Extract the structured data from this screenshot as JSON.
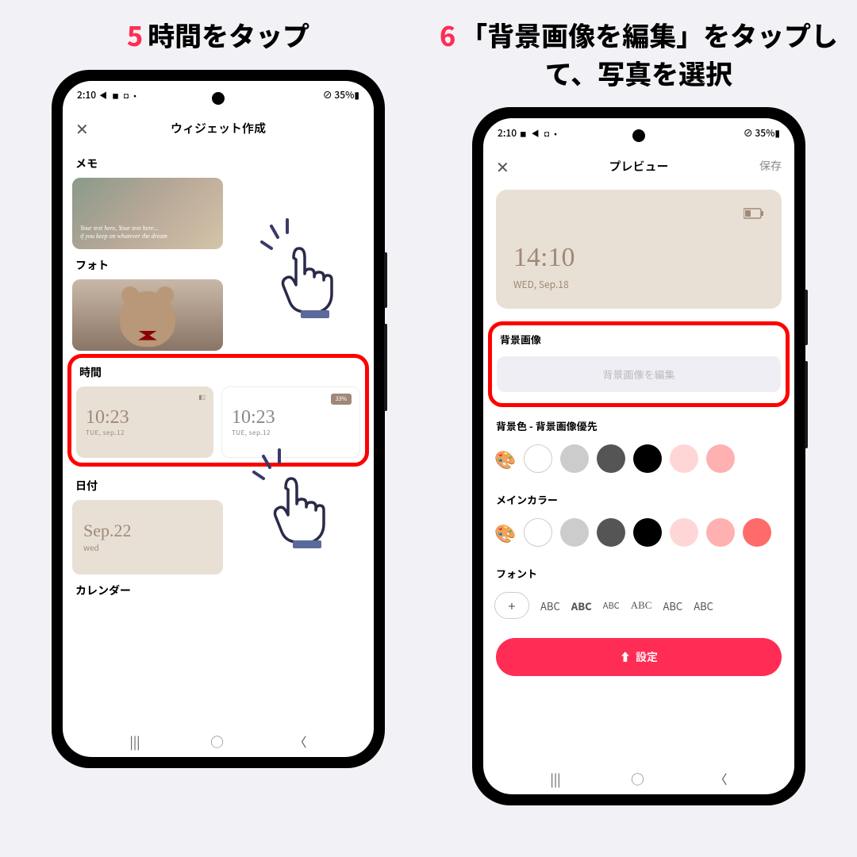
{
  "step5": {
    "num": "5",
    "caption": "時間をタップ",
    "status": {
      "time": "2:10",
      "icons": "◀ ◼ ◘ •",
      "right": "⊘ 35%▮"
    },
    "header": {
      "title": "ウィジェット作成"
    },
    "sections": {
      "memo": "メモ",
      "memo_text1": "Your text here, Your text here...",
      "memo_text2": "if you keep on whatever the dream",
      "photo": "フォト",
      "time": "時間",
      "time_val": "10:23",
      "time_date": "TUE, sep.12",
      "badge": "33%",
      "date": "日付",
      "date_val": "Sep.22",
      "date_day": "wed",
      "calendar": "カレンダー"
    }
  },
  "step6": {
    "num": "6",
    "caption": "「背景画像を編集」をタップして、写真を選択",
    "status": {
      "time": "2:10",
      "icons": "◼ ◀ ◘ •",
      "right": "⊘ 35%▮"
    },
    "header": {
      "title": "プレビュー",
      "save": "保存"
    },
    "preview": {
      "time": "14:10",
      "date": "WED, Sep.18"
    },
    "labels": {
      "bg_image": "背景画像",
      "edit_bg": "背景画像を編集",
      "bg_color": "背景色 - 背景画像優先",
      "main_color": "メインカラー",
      "font": "フォント"
    },
    "fonts": [
      "ABC",
      "ABC",
      "ABC",
      "ABC",
      "ABC",
      "ABC"
    ],
    "settings_btn": "設定"
  }
}
